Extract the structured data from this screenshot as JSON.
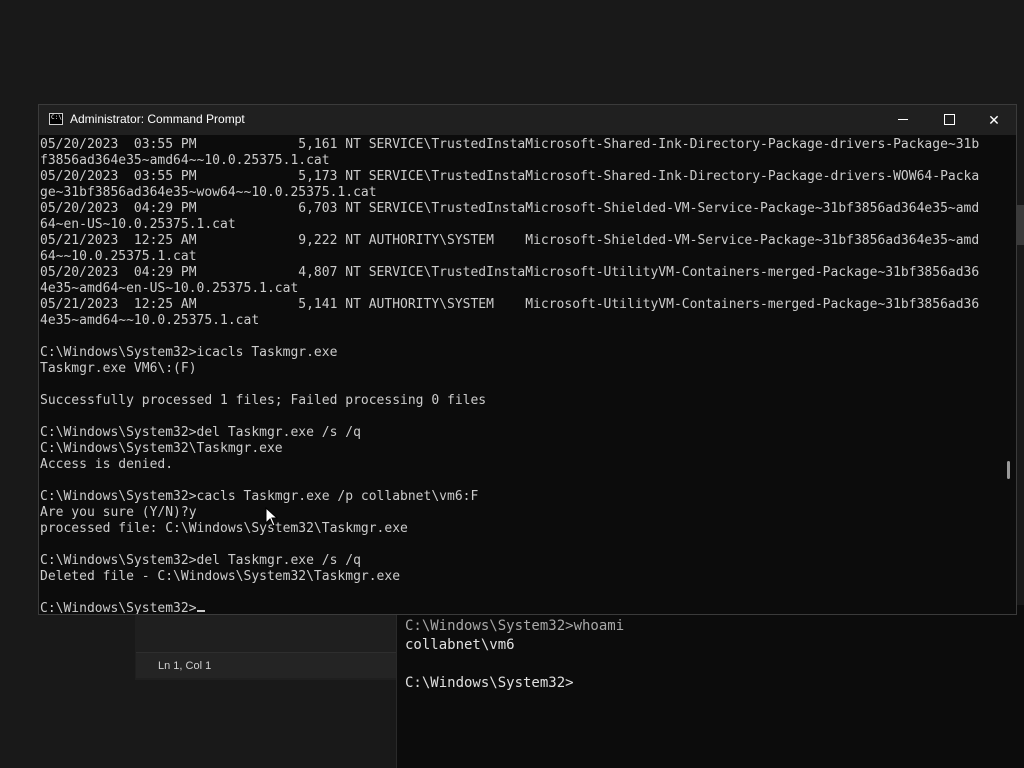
{
  "window": {
    "title": "Administrator: Command Prompt",
    "icon": "cmd-icon",
    "icon_glyph": "C:\\",
    "controls": {
      "minimize": "minimize-icon",
      "maximize": "maximize-icon",
      "close": "close-icon",
      "close_glyph": "✕"
    }
  },
  "console": {
    "lines": [
      "05/20/2023  03:55 PM             5,161 NT SERVICE\\TrustedInstaMicrosoft-Shared-Ink-Directory-Package-drivers-Package~31b",
      "f3856ad364e35~amd64~~10.0.25375.1.cat",
      "05/20/2023  03:55 PM             5,173 NT SERVICE\\TrustedInstaMicrosoft-Shared-Ink-Directory-Package-drivers-WOW64-Packa",
      "ge~31bf3856ad364e35~wow64~~10.0.25375.1.cat",
      "05/20/2023  04:29 PM             6,703 NT SERVICE\\TrustedInstaMicrosoft-Shielded-VM-Service-Package~31bf3856ad364e35~amd",
      "64~en-US~10.0.25375.1.cat",
      "05/21/2023  12:25 AM             9,222 NT AUTHORITY\\SYSTEM    Microsoft-Shielded-VM-Service-Package~31bf3856ad364e35~amd",
      "64~~10.0.25375.1.cat",
      "05/20/2023  04:29 PM             4,807 NT SERVICE\\TrustedInstaMicrosoft-UtilityVM-Containers-merged-Package~31bf3856ad36",
      "4e35~amd64~en-US~10.0.25375.1.cat",
      "05/21/2023  12:25 AM             5,141 NT AUTHORITY\\SYSTEM    Microsoft-UtilityVM-Containers-merged-Package~31bf3856ad36",
      "4e35~amd64~~10.0.25375.1.cat",
      "",
      "C:\\Windows\\System32>icacls Taskmgr.exe",
      "Taskmgr.exe VM6\\:(F)",
      "",
      "Successfully processed 1 files; Failed processing 0 files",
      "",
      "C:\\Windows\\System32>del Taskmgr.exe /s /q",
      "C:\\Windows\\System32\\Taskmgr.exe",
      "Access is denied.",
      "",
      "C:\\Windows\\System32>cacls Taskmgr.exe /p collabnet\\vm6:F",
      "Are you sure (Y/N)?y",
      "processed file: C:\\Windows\\System32\\Taskmgr.exe",
      "",
      "C:\\Windows\\System32>del Taskmgr.exe /s /q",
      "Deleted file - C:\\Windows\\System32\\Taskmgr.exe",
      ""
    ],
    "prompt": "C:\\Windows\\System32>"
  },
  "background_editor": {
    "status": "Ln 1, Col 1"
  },
  "background_terminal": {
    "lines": [
      "C:\\Windows\\System32>whoami",
      "collabnet\\vm6",
      "",
      "C:\\Windows\\System32>"
    ]
  }
}
